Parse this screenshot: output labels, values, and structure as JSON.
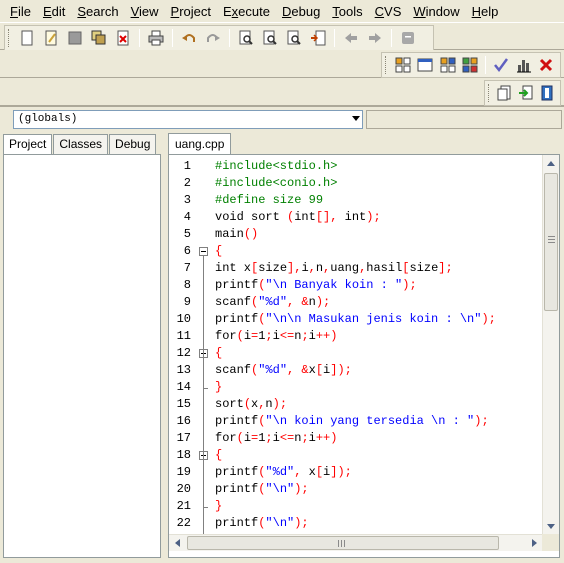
{
  "menu": [
    {
      "label": "File",
      "key": "F"
    },
    {
      "label": "Edit",
      "key": "E"
    },
    {
      "label": "Search",
      "key": "S"
    },
    {
      "label": "View",
      "key": "V"
    },
    {
      "label": "Project",
      "key": "P"
    },
    {
      "label": "Execute",
      "key": "x"
    },
    {
      "label": "Debug",
      "key": "D"
    },
    {
      "label": "Tools",
      "key": "T"
    },
    {
      "label": "CVS",
      "key": "C"
    },
    {
      "label": "Window",
      "key": "W"
    },
    {
      "label": "Help",
      "key": "H"
    }
  ],
  "toolbar": {
    "main_icons": [
      "new-file-icon",
      "open-file-icon",
      "save-icon",
      "save-all-icon",
      "close-file-icon",
      "print-icon",
      "undo-icon",
      "redo-icon",
      "find-icon",
      "replace-icon",
      "find-next-icon",
      "goto-line-icon",
      "back-icon",
      "forward-icon",
      "bookmark-icon"
    ],
    "compile_icons": [
      "compile-icon",
      "run-icon",
      "compile-run-icon",
      "rebuild-icon",
      "debug-check-icon",
      "chart-icon",
      "stop-icon"
    ],
    "project_icons": [
      "add-to-project-icon",
      "remove-from-project-icon",
      "project-options-icon"
    ]
  },
  "globals_combo": "(globals)",
  "left_tabs": [
    "Project",
    "Classes",
    "Debug"
  ],
  "editor_tab": "uang.cpp",
  "colors": {
    "preprocessor": "#008000",
    "string": "#0000ff",
    "symbol": "#ff0000",
    "text": "#000000"
  },
  "code_lines": [
    {
      "n": "1",
      "tokens": [
        [
          "pre",
          "#include<stdio.h>"
        ]
      ]
    },
    {
      "n": "2",
      "tokens": [
        [
          "pre",
          "#include<conio.h>"
        ]
      ]
    },
    {
      "n": "3",
      "tokens": [
        [
          "pre",
          "#define size 99"
        ]
      ]
    },
    {
      "n": "4",
      "tokens": [
        [
          "txt",
          "void sort "
        ],
        [
          "sym",
          "("
        ],
        [
          "txt",
          "int"
        ],
        [
          "sym",
          "[],"
        ],
        [
          "txt",
          " int"
        ],
        [
          "sym",
          ");"
        ]
      ]
    },
    {
      "n": "5",
      "tokens": [
        [
          "txt",
          "main"
        ],
        [
          "sym",
          "()"
        ]
      ]
    },
    {
      "n": "6",
      "fold": "open",
      "tokens": [
        [
          "sym",
          "{"
        ]
      ]
    },
    {
      "n": "7",
      "tokens": [
        [
          "txt",
          "int x"
        ],
        [
          "sym",
          "["
        ],
        [
          "txt",
          "size"
        ],
        [
          "sym",
          "],"
        ],
        [
          "txt",
          "i"
        ],
        [
          "sym",
          ","
        ],
        [
          "txt",
          "n"
        ],
        [
          "sym",
          ","
        ],
        [
          "txt",
          "uang"
        ],
        [
          "sym",
          ","
        ],
        [
          "txt",
          "hasil"
        ],
        [
          "sym",
          "["
        ],
        [
          "txt",
          "size"
        ],
        [
          "sym",
          "];"
        ]
      ]
    },
    {
      "n": "8",
      "tokens": [
        [
          "txt",
          "printf"
        ],
        [
          "sym",
          "("
        ],
        [
          "str",
          "\"\\n Banyak koin : \""
        ],
        [
          "sym",
          ");"
        ]
      ]
    },
    {
      "n": "9",
      "tokens": [
        [
          "txt",
          "scanf"
        ],
        [
          "sym",
          "("
        ],
        [
          "str",
          "\"%d\""
        ],
        [
          "sym",
          ", &"
        ],
        [
          "txt",
          "n"
        ],
        [
          "sym",
          ");"
        ]
      ]
    },
    {
      "n": "10",
      "tokens": [
        [
          "txt",
          "printf"
        ],
        [
          "sym",
          "("
        ],
        [
          "str",
          "\"\\n\\n Masukan jenis koin : \\n\""
        ],
        [
          "sym",
          ");"
        ]
      ]
    },
    {
      "n": "11",
      "tokens": [
        [
          "txt",
          "for"
        ],
        [
          "sym",
          "("
        ],
        [
          "txt",
          "i"
        ],
        [
          "sym",
          "="
        ],
        [
          "txt",
          "1"
        ],
        [
          "sym",
          ";"
        ],
        [
          "txt",
          "i"
        ],
        [
          "sym",
          "<="
        ],
        [
          "txt",
          "n"
        ],
        [
          "sym",
          ";"
        ],
        [
          "txt",
          "i"
        ],
        [
          "sym",
          "++)"
        ]
      ]
    },
    {
      "n": "12",
      "fold": "open",
      "tokens": [
        [
          "sym",
          "{"
        ]
      ]
    },
    {
      "n": "13",
      "tokens": [
        [
          "txt",
          "scanf"
        ],
        [
          "sym",
          "("
        ],
        [
          "str",
          "\"%d\""
        ],
        [
          "sym",
          ", &"
        ],
        [
          "txt",
          "x"
        ],
        [
          "sym",
          "["
        ],
        [
          "txt",
          "i"
        ],
        [
          "sym",
          "]);"
        ]
      ]
    },
    {
      "n": "14",
      "fold": "end",
      "tokens": [
        [
          "sym",
          "}"
        ]
      ]
    },
    {
      "n": "15",
      "tokens": [
        [
          "txt",
          "sort"
        ],
        [
          "sym",
          "("
        ],
        [
          "txt",
          "x"
        ],
        [
          "sym",
          ","
        ],
        [
          "txt",
          "n"
        ],
        [
          "sym",
          ");"
        ]
      ]
    },
    {
      "n": "16",
      "tokens": [
        [
          "txt",
          "printf"
        ],
        [
          "sym",
          "("
        ],
        [
          "str",
          "\"\\n koin yang tersedia \\n : \""
        ],
        [
          "sym",
          ");"
        ]
      ]
    },
    {
      "n": "17",
      "tokens": [
        [
          "txt",
          "for"
        ],
        [
          "sym",
          "("
        ],
        [
          "txt",
          "i"
        ],
        [
          "sym",
          "="
        ],
        [
          "txt",
          "1"
        ],
        [
          "sym",
          ";"
        ],
        [
          "txt",
          "i"
        ],
        [
          "sym",
          "<="
        ],
        [
          "txt",
          "n"
        ],
        [
          "sym",
          ";"
        ],
        [
          "txt",
          "i"
        ],
        [
          "sym",
          "++)"
        ]
      ]
    },
    {
      "n": "18",
      "fold": "open",
      "tokens": [
        [
          "sym",
          "{"
        ]
      ]
    },
    {
      "n": "19",
      "tokens": [
        [
          "txt",
          "printf"
        ],
        [
          "sym",
          "("
        ],
        [
          "str",
          "\"%d\""
        ],
        [
          "sym",
          ", "
        ],
        [
          "txt",
          "x"
        ],
        [
          "sym",
          "["
        ],
        [
          "txt",
          "i"
        ],
        [
          "sym",
          "]);"
        ]
      ]
    },
    {
      "n": "20",
      "tokens": [
        [
          "txt",
          "printf"
        ],
        [
          "sym",
          "("
        ],
        [
          "str",
          "\"\\n\""
        ],
        [
          "sym",
          ");"
        ]
      ]
    },
    {
      "n": "21",
      "fold": "end",
      "tokens": [
        [
          "sym",
          "}"
        ]
      ]
    },
    {
      "n": "22",
      "tokens": [
        [
          "txt",
          "printf"
        ],
        [
          "sym",
          "("
        ],
        [
          "str",
          "\"\\n\""
        ],
        [
          "sym",
          ");"
        ]
      ]
    }
  ]
}
